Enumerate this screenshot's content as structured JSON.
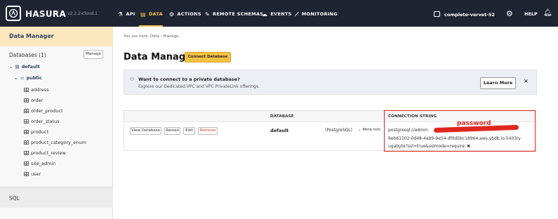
{
  "topbar": {
    "brand": "HASURA",
    "version": "v2.2.2-cloud.1",
    "nav": [
      {
        "label": "API",
        "icon": "flask-icon"
      },
      {
        "label": "DATA",
        "icon": "database-icon",
        "active": true
      },
      {
        "label": "ACTIONS",
        "icon": "actions-icon"
      },
      {
        "label": "REMOTE SCHEMAS",
        "icon": "plug-icon"
      },
      {
        "label": "EVENTS",
        "icon": "cloud-icon"
      },
      {
        "label": "MONITORING",
        "icon": "chart-icon"
      }
    ],
    "project": "complete-vervet-52",
    "help": "HELP",
    "accent_color": "#f5c144",
    "background_color": "#1f2433"
  },
  "sidebar": {
    "header": "Data Manager",
    "databases_label": "Databases (1)",
    "manage_label": "Manage",
    "db": "default",
    "schema": "public",
    "tables": [
      "address",
      "order",
      "order_product",
      "order_status",
      "product",
      "product_category_enum",
      "product_review",
      "site_admin",
      "user"
    ],
    "sql_label": "SQL"
  },
  "main": {
    "breadcrumb": "You are here: Data › Manage",
    "title": "Data Manager",
    "connect_button": "Connect Database",
    "banner": {
      "title": "Want to connect to a private database?",
      "subtitle": "Explore our Dedicated VPC and VPC PrivateLink offerings.",
      "learn_more": "Learn More",
      "close": "×"
    },
    "table": {
      "col_database": "DATABASE",
      "col_connection": "CONNECTION STRING",
      "actions": [
        "View Database",
        "Reload",
        "Edit",
        "Remove"
      ],
      "db_name": "default",
      "db_type": "(PostgreSQL)",
      "more_info": "More info",
      "conn_lines": [
        "postgresql://admin:",
        "6eb61102-0d48-4ab9-9e54-df0d5bc18964.aws.ybdb.io:5433/y",
        "ugabyte?ssl=true&sslmode=require"
      ],
      "password_note": "password"
    }
  }
}
